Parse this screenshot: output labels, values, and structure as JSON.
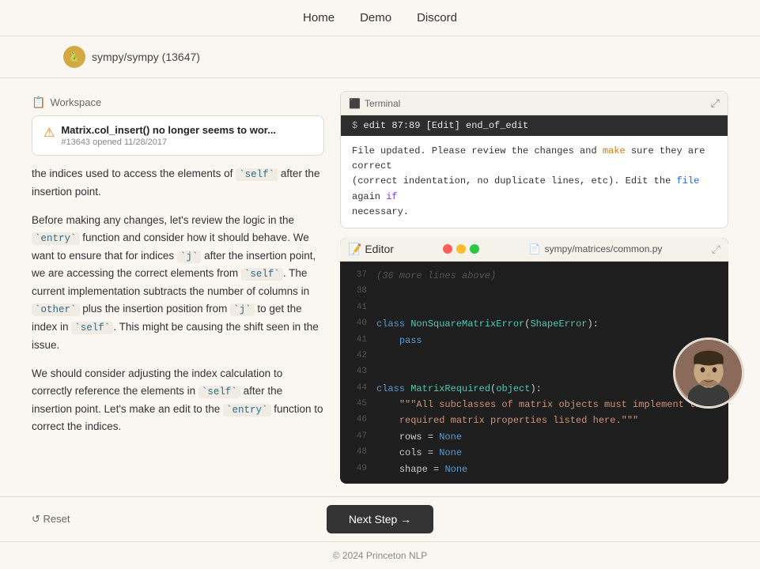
{
  "header": {
    "nav": [
      {
        "label": "Home",
        "href": "#"
      },
      {
        "label": "Demo",
        "href": "#"
      },
      {
        "label": "Discord",
        "href": "#"
      }
    ]
  },
  "breadcrumb": {
    "repo": "sympy/sympy (13647)"
  },
  "workspace": {
    "title": "Workspace",
    "issue": {
      "title": "Matrix.col_insert() no longer seems to wor...",
      "meta": "#13643 opened 11/28/2017"
    },
    "paragraphs": [
      {
        "id": "p1",
        "parts": [
          {
            "text": "the indices used to access the elements of "
          },
          {
            "code": "self"
          },
          {
            "text": " after the insertion point."
          }
        ]
      },
      {
        "id": "p2",
        "parts": [
          {
            "text": "Before making any changes, let’s review the logic in the "
          },
          {
            "code": "entry"
          },
          {
            "text": " function and consider how it should behave. We want to ensure that for indices "
          },
          {
            "code": "j"
          },
          {
            "text": " after the insertion point, we are accessing the correct elements from "
          },
          {
            "code": "self"
          },
          {
            "text": ". The current implementation subtracts the number of columns in "
          },
          {
            "code": "other"
          },
          {
            "text": " plus the insertion position from "
          },
          {
            "code": "j"
          },
          {
            "text": " to get the index in "
          },
          {
            "code": "self"
          },
          {
            "text": ". This might be causing the shift seen in the issue."
          }
        ]
      },
      {
        "id": "p3",
        "parts": [
          {
            "text": "We should consider adjusting the index calculation to correctly reference the elements in "
          },
          {
            "code": "self"
          },
          {
            "text": " after the insertion point. Let’s make an edit to the "
          },
          {
            "code": "entry"
          },
          {
            "text": " function to correct the indices."
          }
        ]
      }
    ]
  },
  "terminal": {
    "title": "Terminal",
    "command": "edit 87:89 [Edit] end_of_edit",
    "output_lines": [
      {
        "text": "File updated. Please review the changes and ",
        "highlight": null
      },
      {
        "text": "make",
        "highlight": "make"
      },
      {
        "text": " sure they are correct",
        "highlight": null
      },
      {
        "text": "(correct indentation, no duplicate lines, etc). Edit the ",
        "highlight": null
      },
      {
        "text": "file",
        "highlight": "file"
      },
      {
        "text": " again ",
        "highlight": null
      },
      {
        "text": "if",
        "highlight": "if"
      },
      {
        "text": " necessary.",
        "highlight": null
      }
    ]
  },
  "editor": {
    "title": "Editor",
    "filename": "sympy/matrices/common.py",
    "lines": [
      {
        "num": "37",
        "content": "(36 more lines above)",
        "type": "gray"
      },
      {
        "num": "38",
        "content": "",
        "type": "normal"
      },
      {
        "num": "41",
        "content": "",
        "type": "normal"
      },
      {
        "num": "40",
        "content": "class NonSquareMatrixError(ShapeError):",
        "type": "class"
      },
      {
        "num": "41",
        "content": "    pass",
        "type": "keyword"
      },
      {
        "num": "42",
        "content": "",
        "type": "normal"
      },
      {
        "num": "43",
        "content": "",
        "type": "normal"
      },
      {
        "num": "44",
        "content": "class MatrixRequired(object):",
        "type": "class"
      },
      {
        "num": "45",
        "content": "    \"\"\"All subclasses of matrix objects must implement the",
        "type": "string"
      },
      {
        "num": "46",
        "content": "    required matrix properties listed here.\"\"\"",
        "type": "string"
      },
      {
        "num": "47",
        "content": "    rows = None",
        "type": "normal"
      },
      {
        "num": "48",
        "content": "    cols = None",
        "type": "normal"
      },
      {
        "num": "49",
        "content": "    shape = None",
        "type": "normal"
      }
    ]
  },
  "bottom": {
    "reset_label": "↺ Reset",
    "next_step_label": "Next Step →"
  },
  "footer": {
    "text": "© 2024 Princeton NLP"
  }
}
